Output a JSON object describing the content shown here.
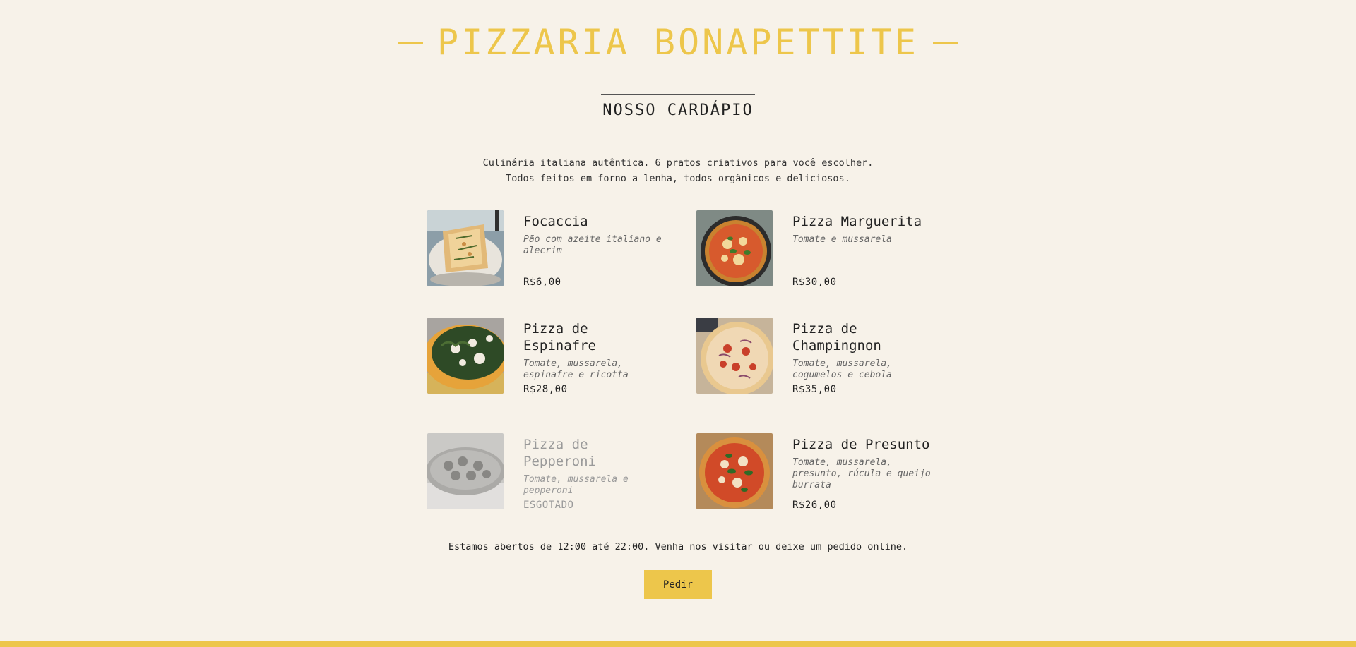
{
  "brand": {
    "title": "PIZZARIA BONAPETTITE",
    "accent_color": "#edc64b"
  },
  "menu_section": {
    "title": "NOSSO CARDÁPIO",
    "intro_line_1": "Culinária italiana autêntica. 6 pratos criativos para você escolher.",
    "intro_line_2": "Todos feitos em forno a lenha, todos orgânicos e deliciosos."
  },
  "items": [
    {
      "name": "Focaccia",
      "description": "Pão com azeite italiano e alecrim",
      "price": "R$6,00",
      "available": true
    },
    {
      "name": "Pizza Marguerita",
      "description": "Tomate e mussarela",
      "price": "R$30,00",
      "available": true
    },
    {
      "name": "Pizza de Espinafre",
      "description": "Tomate, mussarela, espinafre e ricotta",
      "price": "R$28,00",
      "available": true
    },
    {
      "name": "Pizza de Champingnon",
      "description": "Tomate, mussarela, cogumelos e cebola",
      "price": "R$35,00",
      "available": true
    },
    {
      "name": "Pizza de Pepperoni",
      "description": "Tomate, mussarela e pepperoni",
      "price": "ESGOTADO",
      "available": false
    },
    {
      "name": "Pizza de Presunto",
      "description": "Tomate, mussarela, presunto, rúcula e queijo burrata",
      "price": "R$26,00",
      "available": true
    }
  ],
  "footer": {
    "hours_text": "Estamos abertos de 12:00 até 22:00. Venha nos visitar ou deixe um pedido online.",
    "order_button_label": "Pedir"
  }
}
